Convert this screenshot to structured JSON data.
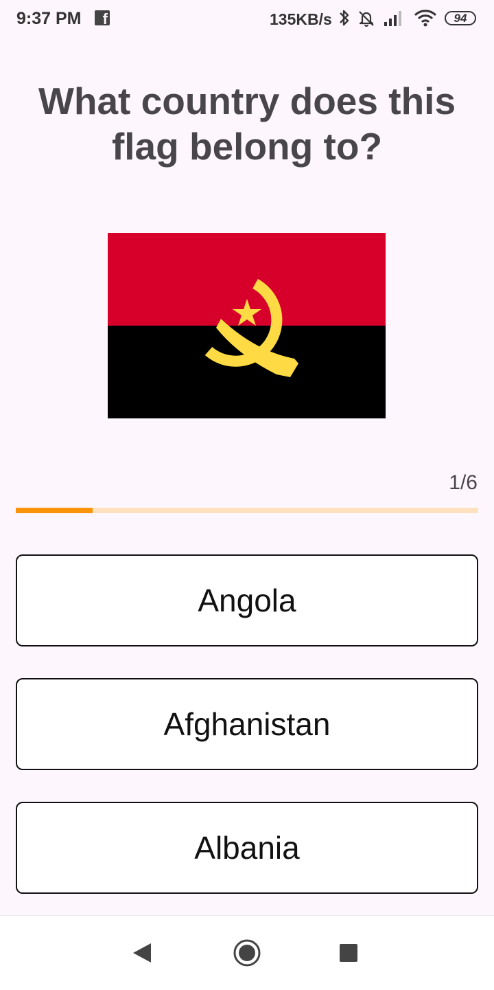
{
  "status_bar": {
    "time": "9:37 PM",
    "notification_icon": "facebook-icon",
    "network_speed": "135KB/s",
    "icons": [
      "bluetooth-icon",
      "alarm-off-icon",
      "signal-icon",
      "wifi-icon"
    ],
    "battery_level": "94"
  },
  "quiz": {
    "question": "What country does this flag belong to?",
    "flag_icon": "angola-flag",
    "flag_colors": {
      "top": "#d7002b",
      "bottom": "#000000",
      "emblem": "#fedb44"
    },
    "progress_text": "1/6",
    "progress_fraction": 0.1667,
    "progress_colors": {
      "fill": "#f9940b",
      "track": "#fde0bd"
    },
    "answers": [
      {
        "label": "Angola"
      },
      {
        "label": "Afghanistan"
      },
      {
        "label": "Albania"
      }
    ]
  },
  "nav_bar": {
    "buttons": [
      "back-icon",
      "home-icon",
      "recents-icon"
    ]
  }
}
